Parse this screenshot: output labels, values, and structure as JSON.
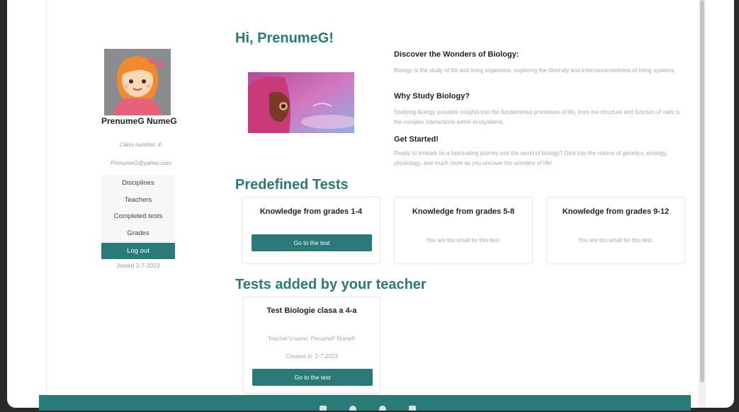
{
  "user": {
    "name": "PrenumeG NumeG",
    "class_number": "Class number: 4",
    "email": "PrenumeG@yahoo.com",
    "joined": "Joined 2-7-2023"
  },
  "menu": {
    "items": [
      {
        "label": "Disciplines"
      },
      {
        "label": "Teachers"
      },
      {
        "label": "Completed tests"
      },
      {
        "label": "Grades"
      }
    ],
    "logout_label": "Log out"
  },
  "greeting": "Hi, PrenumeG!",
  "info": {
    "sections": [
      {
        "title": "Discover the Wonders of Biology:",
        "text": "Biology is the study of life and living organisms, exploring the diversity and interconnectedness of living systems."
      },
      {
        "title": "Why Study Biology?",
        "text": "Studying biology provides insights into the fundamental processes of life, from the structure and function of cells to the complex interactions within ecosystems."
      },
      {
        "title": "Get Started!",
        "text": "Ready to embark on a fascinating journey into the world of biology? Dive into the realms of genetics, ecology, physiology, and much more as you uncover the wonders of life!"
      }
    ]
  },
  "predefined": {
    "title": "Predefined Tests",
    "cards": [
      {
        "title": "Knowledge from grades 1-4",
        "button": "Go to the test"
      },
      {
        "title": "Knowledge from grades 5-8",
        "note": "You are too small for this test."
      },
      {
        "title": "Knowledge from grades 9-12",
        "note": "You are too small for this test."
      }
    ]
  },
  "teacher_tests": {
    "title": "Tests added by your teacher",
    "cards": [
      {
        "title": "Test Biologie clasa a 4-a",
        "teacher": "Teacher's name: PenumeF NumeF",
        "created": "Created in: 2-7-2023",
        "button": "Go to the test"
      }
    ]
  },
  "colors": {
    "accent": "#2a7a78",
    "muted_text": "#a8a8a8",
    "frame": "#2a2a2a"
  },
  "icons": [
    "user-avatar",
    "hero-illustration",
    "footer-social-icons"
  ]
}
